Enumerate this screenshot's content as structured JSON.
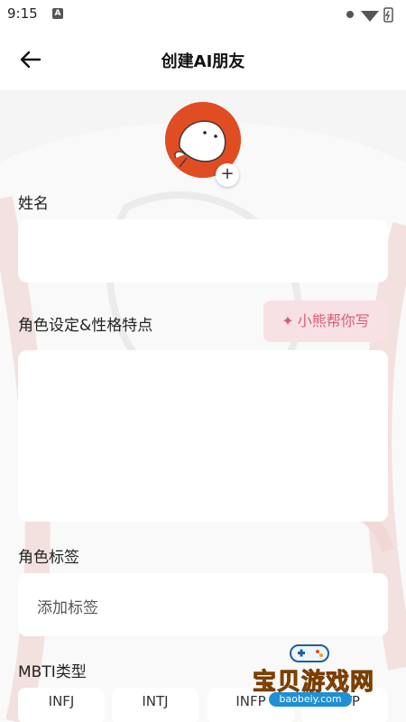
{
  "status_bar": {
    "time": "9:15",
    "app_icon_letter": "A"
  },
  "header": {
    "title": "创建AI朋友"
  },
  "form": {
    "name_label": "姓名",
    "name_value": "",
    "personality_label": "角色设定&性格特点",
    "helper_button_label": "小熊帮你写",
    "personality_value": "",
    "tags_label": "角色标签",
    "tags_placeholder": "添加标签",
    "mbti_label": "MBTI类型",
    "mbti_options": [
      "INFJ",
      "INTJ",
      "INFP",
      "INTP"
    ]
  },
  "watermark": {
    "text": "宝贝游戏网",
    "url": "baobeiy.com"
  },
  "colors": {
    "accent_pink": "#d95a79",
    "helper_bg": "#f7e1e4",
    "avatar_red": "#e04d22",
    "page_bg": "#f5f5f5"
  }
}
